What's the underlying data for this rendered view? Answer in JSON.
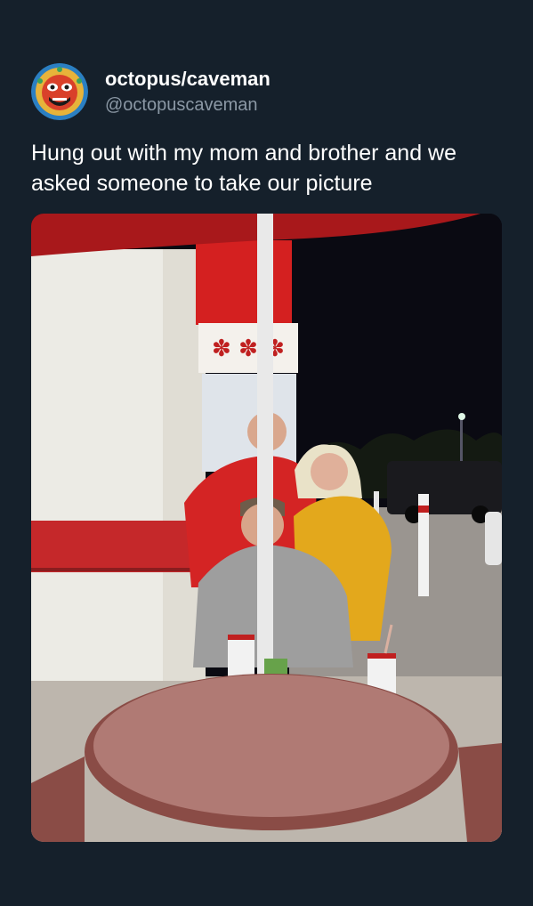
{
  "author": {
    "display_name": "octopus/caveman",
    "handle": "@octopuscaveman",
    "avatar_icon": "aztec-mask-avatar-icon"
  },
  "tweet": {
    "text": "Hung out with my mom and brother and we asked someone to take our picture"
  },
  "colors": {
    "background": "#15202b",
    "handle": "#8b98a5",
    "text": "#ffffff"
  }
}
